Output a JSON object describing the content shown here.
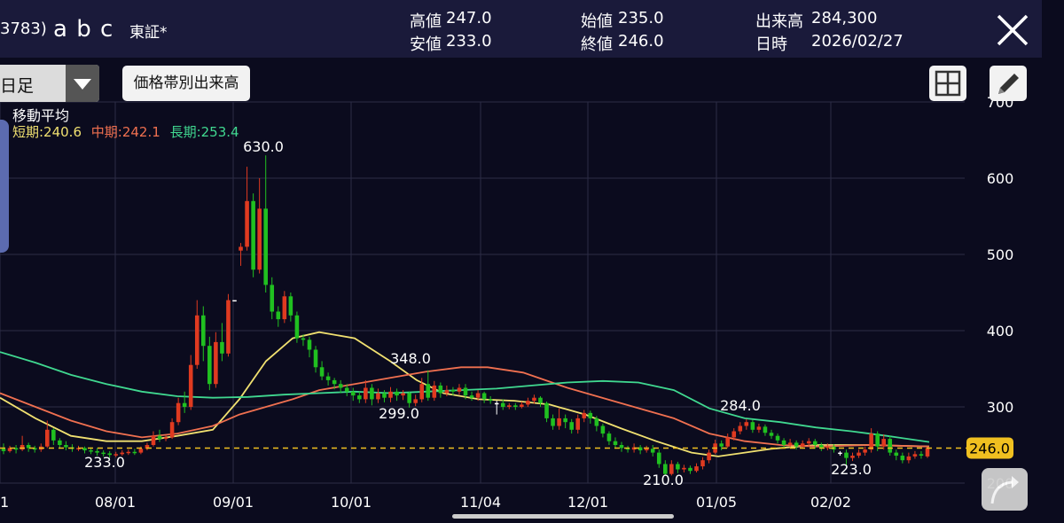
{
  "header": {
    "code": "3783)",
    "name": "a b c",
    "market": "東証*",
    "high_label": "高値",
    "high": "247.0",
    "low_label": "安値",
    "low": "233.0",
    "open_label": "始値",
    "open": "235.0",
    "close_label": "終値",
    "close": "246.0",
    "volume_label": "出来高",
    "volume": "284,300",
    "date_label": "日時",
    "date": "2026/02/27"
  },
  "toolbar": {
    "period": "日足",
    "volume_by_price": "価格帯別出来高"
  },
  "legend": {
    "title": "移動平均",
    "short": "短期:240.6",
    "mid": "中期:242.1",
    "long": "長期:253.4"
  },
  "colors": {
    "short": "#f0e070",
    "mid": "#f07050",
    "long": "#40d890",
    "up": "#e03a20",
    "down": "#20c020",
    "price_tag": "#f0c020"
  },
  "chart_data": {
    "type": "candlestick",
    "ylim": [
      200,
      700
    ],
    "y_ticks": [
      200,
      300,
      400,
      500,
      600,
      700
    ],
    "x_tick_labels": [
      "1",
      "08/01",
      "09/01",
      "10/01",
      "11/04",
      "12/01",
      "01/05",
      "02/02"
    ],
    "current_price": 246.0,
    "current_price_label": "246.0",
    "annotations": [
      {
        "label": "630.0",
        "value": 630.0,
        "date": "09/08"
      },
      {
        "label": "233.0",
        "value": 233.0,
        "date": "07/24"
      },
      {
        "label": "348.0",
        "value": 348.0,
        "date": "10/23"
      },
      {
        "label": "299.0",
        "value": 299.0,
        "date": "10/16"
      },
      {
        "label": "284.0",
        "value": 284.0,
        "date": "01/09"
      },
      {
        "label": "210.0",
        "value": 210.0,
        "date": "12/19"
      },
      {
        "label": "223.0",
        "value": 223.0,
        "date": "02/13"
      }
    ],
    "candles": [
      {
        "o": 245,
        "c": 242,
        "h": 252,
        "l": 238
      },
      {
        "o": 242,
        "c": 246,
        "h": 249,
        "l": 240
      },
      {
        "o": 246,
        "c": 244,
        "h": 250,
        "l": 239
      },
      {
        "o": 244,
        "c": 250,
        "h": 262,
        "l": 242
      },
      {
        "o": 250,
        "c": 246,
        "h": 253,
        "l": 241
      },
      {
        "o": 246,
        "c": 244,
        "h": 249,
        "l": 240
      },
      {
        "o": 244,
        "c": 248,
        "h": 252,
        "l": 241
      },
      {
        "o": 248,
        "c": 270,
        "h": 282,
        "l": 246
      },
      {
        "o": 270,
        "c": 256,
        "h": 272,
        "l": 250
      },
      {
        "o": 256,
        "c": 250,
        "h": 259,
        "l": 246
      },
      {
        "o": 250,
        "c": 247,
        "h": 255,
        "l": 243
      },
      {
        "o": 247,
        "c": 245,
        "h": 251,
        "l": 241
      },
      {
        "o": 245,
        "c": 246,
        "h": 249,
        "l": 242
      },
      {
        "o": 246,
        "c": 243,
        "h": 248,
        "l": 239
      },
      {
        "o": 243,
        "c": 242,
        "h": 247,
        "l": 238
      },
      {
        "o": 242,
        "c": 240,
        "h": 246,
        "l": 236
      },
      {
        "o": 240,
        "c": 239,
        "h": 243,
        "l": 235
      },
      {
        "o": 239,
        "c": 237,
        "h": 242,
        "l": 233
      },
      {
        "o": 237,
        "c": 238,
        "h": 241,
        "l": 234
      },
      {
        "o": 238,
        "c": 240,
        "h": 243,
        "l": 236
      },
      {
        "o": 240,
        "c": 241,
        "h": 244,
        "l": 237
      },
      {
        "o": 241,
        "c": 240,
        "h": 245,
        "l": 237
      },
      {
        "o": 240,
        "c": 245,
        "h": 248,
        "l": 238
      },
      {
        "o": 245,
        "c": 250,
        "h": 253,
        "l": 243
      },
      {
        "o": 250,
        "c": 262,
        "h": 268,
        "l": 248
      },
      {
        "o": 262,
        "c": 258,
        "h": 270,
        "l": 254
      },
      {
        "o": 258,
        "c": 260,
        "h": 263,
        "l": 255
      },
      {
        "o": 260,
        "c": 280,
        "h": 285,
        "l": 258
      },
      {
        "o": 280,
        "c": 305,
        "h": 312,
        "l": 276
      },
      {
        "o": 305,
        "c": 300,
        "h": 320,
        "l": 292
      },
      {
        "o": 300,
        "c": 355,
        "h": 368,
        "l": 296
      },
      {
        "o": 355,
        "c": 420,
        "h": 440,
        "l": 350
      },
      {
        "o": 420,
        "c": 380,
        "h": 432,
        "l": 360
      },
      {
        "o": 380,
        "c": 330,
        "h": 392,
        "l": 322
      },
      {
        "o": 330,
        "c": 385,
        "h": 398,
        "l": 325
      },
      {
        "o": 385,
        "c": 370,
        "h": 410,
        "l": 360
      },
      {
        "o": 370,
        "c": 440,
        "h": 448,
        "l": 366
      },
      {
        "o": 440,
        "c": 440,
        "h": 440,
        "l": 440
      },
      {
        "o": 505,
        "c": 510,
        "h": 515,
        "l": 485
      },
      {
        "o": 510,
        "c": 570,
        "h": 615,
        "l": 505
      },
      {
        "o": 570,
        "c": 480,
        "h": 580,
        "l": 470
      },
      {
        "o": 480,
        "c": 560,
        "h": 600,
        "l": 475
      },
      {
        "o": 560,
        "c": 460,
        "h": 630,
        "l": 450
      },
      {
        "o": 460,
        "c": 425,
        "h": 470,
        "l": 415
      },
      {
        "o": 425,
        "c": 415,
        "h": 432,
        "l": 405
      },
      {
        "o": 415,
        "c": 445,
        "h": 452,
        "l": 410
      },
      {
        "o": 445,
        "c": 420,
        "h": 450,
        "l": 412
      },
      {
        "o": 420,
        "c": 390,
        "h": 425,
        "l": 384
      },
      {
        "o": 390,
        "c": 388,
        "h": 395,
        "l": 380
      },
      {
        "o": 388,
        "c": 375,
        "h": 392,
        "l": 365
      },
      {
        "o": 375,
        "c": 352,
        "h": 380,
        "l": 345
      },
      {
        "o": 352,
        "c": 340,
        "h": 360,
        "l": 335
      },
      {
        "o": 340,
        "c": 335,
        "h": 345,
        "l": 328
      },
      {
        "o": 335,
        "c": 330,
        "h": 338,
        "l": 323
      },
      {
        "o": 330,
        "c": 325,
        "h": 335,
        "l": 318
      },
      {
        "o": 325,
        "c": 320,
        "h": 330,
        "l": 314
      },
      {
        "o": 320,
        "c": 315,
        "h": 325,
        "l": 308
      },
      {
        "o": 315,
        "c": 310,
        "h": 320,
        "l": 305
      },
      {
        "o": 310,
        "c": 325,
        "h": 335,
        "l": 305
      },
      {
        "o": 325,
        "c": 310,
        "h": 330,
        "l": 302
      },
      {
        "o": 310,
        "c": 318,
        "h": 324,
        "l": 305
      },
      {
        "o": 318,
        "c": 312,
        "h": 322,
        "l": 306
      },
      {
        "o": 312,
        "c": 320,
        "h": 326,
        "l": 306
      },
      {
        "o": 320,
        "c": 315,
        "h": 324,
        "l": 308
      },
      {
        "o": 315,
        "c": 318,
        "h": 322,
        "l": 309
      },
      {
        "o": 318,
        "c": 305,
        "h": 320,
        "l": 299
      },
      {
        "o": 305,
        "c": 310,
        "h": 316,
        "l": 301
      },
      {
        "o": 310,
        "c": 330,
        "h": 338,
        "l": 306
      },
      {
        "o": 330,
        "c": 312,
        "h": 348,
        "l": 308
      },
      {
        "o": 312,
        "c": 328,
        "h": 334,
        "l": 308
      },
      {
        "o": 328,
        "c": 318,
        "h": 332,
        "l": 312
      },
      {
        "o": 318,
        "c": 322,
        "h": 328,
        "l": 314
      },
      {
        "o": 322,
        "c": 320,
        "h": 326,
        "l": 315
      },
      {
        "o": 320,
        "c": 325,
        "h": 330,
        "l": 316
      },
      {
        "o": 325,
        "c": 315,
        "h": 330,
        "l": 310
      },
      {
        "o": 315,
        "c": 312,
        "h": 320,
        "l": 308
      },
      {
        "o": 312,
        "c": 318,
        "h": 322,
        "l": 308
      },
      {
        "o": 318,
        "c": 310,
        "h": 320,
        "l": 305
      },
      {
        "o": 310,
        "c": 308,
        "h": 314,
        "l": 304
      },
      {
        "o": 305,
        "c": 305,
        "h": 308,
        "l": 290
      },
      {
        "o": 305,
        "c": 300,
        "h": 310,
        "l": 296
      },
      {
        "o": 300,
        "c": 302,
        "h": 305,
        "l": 297
      },
      {
        "o": 302,
        "c": 300,
        "h": 305,
        "l": 296
      },
      {
        "o": 300,
        "c": 303,
        "h": 307,
        "l": 298
      },
      {
        "o": 303,
        "c": 308,
        "h": 312,
        "l": 300
      },
      {
        "o": 308,
        "c": 312,
        "h": 316,
        "l": 304
      },
      {
        "o": 312,
        "c": 305,
        "h": 314,
        "l": 300
      },
      {
        "o": 305,
        "c": 285,
        "h": 307,
        "l": 280
      },
      {
        "o": 285,
        "c": 275,
        "h": 290,
        "l": 270
      },
      {
        "o": 275,
        "c": 285,
        "h": 298,
        "l": 270
      },
      {
        "o": 285,
        "c": 280,
        "h": 290,
        "l": 272
      },
      {
        "o": 280,
        "c": 270,
        "h": 284,
        "l": 265
      },
      {
        "o": 270,
        "c": 285,
        "h": 290,
        "l": 265
      },
      {
        "o": 285,
        "c": 292,
        "h": 296,
        "l": 280
      },
      {
        "o": 292,
        "c": 285,
        "h": 295,
        "l": 278
      },
      {
        "o": 285,
        "c": 275,
        "h": 288,
        "l": 268
      },
      {
        "o": 275,
        "c": 265,
        "h": 278,
        "l": 260
      },
      {
        "o": 265,
        "c": 255,
        "h": 268,
        "l": 250
      },
      {
        "o": 255,
        "c": 250,
        "h": 260,
        "l": 246
      },
      {
        "o": 250,
        "c": 246,
        "h": 254,
        "l": 241
      },
      {
        "o": 246,
        "c": 244,
        "h": 249,
        "l": 240
      },
      {
        "o": 244,
        "c": 247,
        "h": 252,
        "l": 240
      },
      {
        "o": 247,
        "c": 243,
        "h": 250,
        "l": 238
      },
      {
        "o": 243,
        "c": 245,
        "h": 249,
        "l": 240
      },
      {
        "o": 245,
        "c": 240,
        "h": 250,
        "l": 235
      },
      {
        "o": 240,
        "c": 225,
        "h": 244,
        "l": 220
      },
      {
        "o": 225,
        "c": 212,
        "h": 230,
        "l": 210
      },
      {
        "o": 212,
        "c": 225,
        "h": 230,
        "l": 210
      },
      {
        "o": 225,
        "c": 218,
        "h": 228,
        "l": 213
      },
      {
        "o": 218,
        "c": 220,
        "h": 224,
        "l": 214
      },
      {
        "o": 220,
        "c": 216,
        "h": 223,
        "l": 212
      },
      {
        "o": 216,
        "c": 222,
        "h": 226,
        "l": 214
      },
      {
        "o": 222,
        "c": 230,
        "h": 234,
        "l": 218
      },
      {
        "o": 230,
        "c": 240,
        "h": 244,
        "l": 226
      },
      {
        "o": 240,
        "c": 252,
        "h": 257,
        "l": 238
      },
      {
        "o": 252,
        "c": 248,
        "h": 256,
        "l": 243
      },
      {
        "o": 248,
        "c": 260,
        "h": 265,
        "l": 246
      },
      {
        "o": 260,
        "c": 268,
        "h": 272,
        "l": 256
      },
      {
        "o": 268,
        "c": 275,
        "h": 280,
        "l": 264
      },
      {
        "o": 275,
        "c": 280,
        "h": 284,
        "l": 270
      },
      {
        "o": 280,
        "c": 270,
        "h": 283,
        "l": 266
      },
      {
        "o": 270,
        "c": 274,
        "h": 278,
        "l": 266
      },
      {
        "o": 274,
        "c": 266,
        "h": 277,
        "l": 262
      },
      {
        "o": 266,
        "c": 262,
        "h": 270,
        "l": 258
      },
      {
        "o": 262,
        "c": 256,
        "h": 265,
        "l": 252
      },
      {
        "o": 256,
        "c": 250,
        "h": 259,
        "l": 246
      },
      {
        "o": 250,
        "c": 253,
        "h": 258,
        "l": 247
      },
      {
        "o": 253,
        "c": 248,
        "h": 256,
        "l": 244
      },
      {
        "o": 248,
        "c": 252,
        "h": 256,
        "l": 245
      },
      {
        "o": 252,
        "c": 255,
        "h": 259,
        "l": 248
      },
      {
        "o": 255,
        "c": 250,
        "h": 258,
        "l": 245
      },
      {
        "o": 250,
        "c": 246,
        "h": 253,
        "l": 242
      },
      {
        "o": 246,
        "c": 248,
        "h": 252,
        "l": 243
      },
      {
        "o": 248,
        "c": 244,
        "h": 251,
        "l": 240
      },
      {
        "o": 240,
        "c": 240,
        "h": 242,
        "l": 236
      },
      {
        "o": 240,
        "c": 233,
        "h": 244,
        "l": 223
      },
      {
        "o": 233,
        "c": 236,
        "h": 240,
        "l": 229
      },
      {
        "o": 236,
        "c": 240,
        "h": 244,
        "l": 233
      },
      {
        "o": 240,
        "c": 244,
        "h": 248,
        "l": 236
      },
      {
        "o": 244,
        "c": 265,
        "h": 272,
        "l": 240
      },
      {
        "o": 265,
        "c": 248,
        "h": 268,
        "l": 242
      },
      {
        "o": 248,
        "c": 258,
        "h": 264,
        "l": 244
      },
      {
        "o": 258,
        "c": 240,
        "h": 262,
        "l": 236
      },
      {
        "o": 240,
        "c": 236,
        "h": 244,
        "l": 230
      },
      {
        "o": 236,
        "c": 230,
        "h": 240,
        "l": 226
      },
      {
        "o": 230,
        "c": 235,
        "h": 240,
        "l": 226
      },
      {
        "o": 235,
        "c": 238,
        "h": 242,
        "l": 232
      },
      {
        "o": 238,
        "c": 236,
        "h": 242,
        "l": 232
      },
      {
        "o": 235,
        "c": 246,
        "h": 247,
        "l": 233
      }
    ],
    "series": [
      {
        "key": "short",
        "points": [
          [
            0,
            312
          ],
          [
            40,
            285
          ],
          [
            80,
            262
          ],
          [
            120,
            255
          ],
          [
            160,
            255
          ],
          [
            200,
            262
          ],
          [
            240,
            270
          ],
          [
            270,
            310
          ],
          [
            300,
            360
          ],
          [
            330,
            390
          ],
          [
            360,
            398
          ],
          [
            400,
            390
          ],
          [
            440,
            360
          ],
          [
            470,
            335
          ],
          [
            500,
            318
          ],
          [
            540,
            310
          ],
          [
            580,
            308
          ],
          [
            620,
            303
          ],
          [
            660,
            290
          ],
          [
            700,
            272
          ],
          [
            740,
            255
          ],
          [
            780,
            240
          ],
          [
            810,
            235
          ],
          [
            840,
            240
          ],
          [
            870,
            245
          ],
          [
            920,
            250
          ],
          [
            980,
            250
          ],
          [
            1048,
            248
          ]
        ]
      },
      {
        "key": "mid",
        "points": [
          [
            0,
            318
          ],
          [
            40,
            300
          ],
          [
            80,
            282
          ],
          [
            120,
            268
          ],
          [
            160,
            260
          ],
          [
            200,
            265
          ],
          [
            240,
            275
          ],
          [
            270,
            290
          ],
          [
            300,
            300
          ],
          [
            330,
            310
          ],
          [
            360,
            322
          ],
          [
            400,
            330
          ],
          [
            440,
            338
          ],
          [
            480,
            346
          ],
          [
            520,
            352
          ],
          [
            550,
            352
          ],
          [
            590,
            345
          ],
          [
            640,
            325
          ],
          [
            700,
            305
          ],
          [
            760,
            285
          ],
          [
            800,
            265
          ],
          [
            840,
            255
          ],
          [
            880,
            250
          ],
          [
            920,
            248
          ],
          [
            980,
            250
          ],
          [
            1048,
            248
          ]
        ]
      },
      {
        "key": "long",
        "points": [
          [
            0,
            372
          ],
          [
            40,
            358
          ],
          [
            80,
            342
          ],
          [
            120,
            330
          ],
          [
            160,
            320
          ],
          [
            200,
            314
          ],
          [
            240,
            312
          ],
          [
            280,
            313
          ],
          [
            320,
            316
          ],
          [
            360,
            318
          ],
          [
            400,
            320
          ],
          [
            440,
            318
          ],
          [
            480,
            320
          ],
          [
            520,
            322
          ],
          [
            560,
            324
          ],
          [
            600,
            328
          ],
          [
            640,
            332
          ],
          [
            680,
            334
          ],
          [
            720,
            332
          ],
          [
            760,
            322
          ],
          [
            800,
            298
          ],
          [
            840,
            285
          ],
          [
            880,
            280
          ],
          [
            920,
            273
          ],
          [
            960,
            268
          ],
          [
            1000,
            262
          ],
          [
            1048,
            254
          ]
        ]
      }
    ]
  }
}
